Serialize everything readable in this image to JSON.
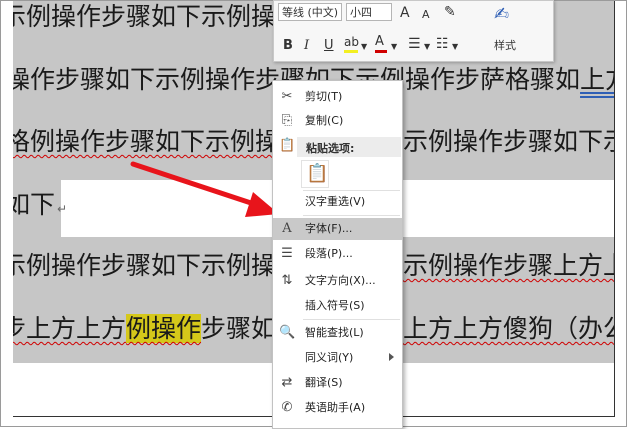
{
  "document": {
    "lines": [
      {
        "text": "示例操作步骤如下示例操"
      },
      {
        "pre": "操作步骤如下示例操作步",
        "mid": "骤如下示例操作步萨格骤如",
        "post": "上方"
      },
      {
        "text": "格例操作步骤如下示例操作步",
        "post": "示例操作步骤如下示"
      },
      {
        "text": "如下",
        "mark": "↵"
      },
      {
        "text": "示例操作步骤如下示例操作",
        "post": "示例操作步骤上方上"
      },
      {
        "pre": "步上方上方",
        "hl": "例操作",
        "mid": "步骤如下",
        "post": "上方上方傻狗（办公软"
      }
    ]
  },
  "mini_toolbar": {
    "font_name": "等线 (中文)",
    "font_size": "小四",
    "grow": "A",
    "shrink": "A",
    "bold": "B",
    "italic": "I",
    "underline": "U",
    "font_color": "A",
    "styles_label": "样式"
  },
  "context_menu": {
    "items": [
      {
        "label": "剪切(T)",
        "icon": "scissors-icon"
      },
      {
        "label": "复制(C)",
        "icon": "copy-icon"
      },
      {
        "label": "粘贴选项:",
        "icon": "clipboard-icon"
      },
      {
        "label": "汉字重选(V)"
      },
      {
        "label": "字体(F)...",
        "icon": "font-icon"
      },
      {
        "label": "段落(P)...",
        "icon": "paragraph-icon"
      },
      {
        "label": "文字方向(X)...",
        "icon": "text-direction-icon"
      },
      {
        "label": "插入符号(S)"
      },
      {
        "label": "智能查找(L)",
        "icon": "smart-lookup-icon"
      },
      {
        "label": "同义词(Y)"
      },
      {
        "label": "翻译(S)",
        "icon": "translate-icon"
      },
      {
        "label": "英语助手(A)",
        "icon": "english-assistant-icon"
      }
    ]
  },
  "colors": {
    "selection": "#c6c6c6",
    "highlight": "#d5c81a",
    "arrow": "#e8141b",
    "menu_hover": "#c9c9c9"
  }
}
